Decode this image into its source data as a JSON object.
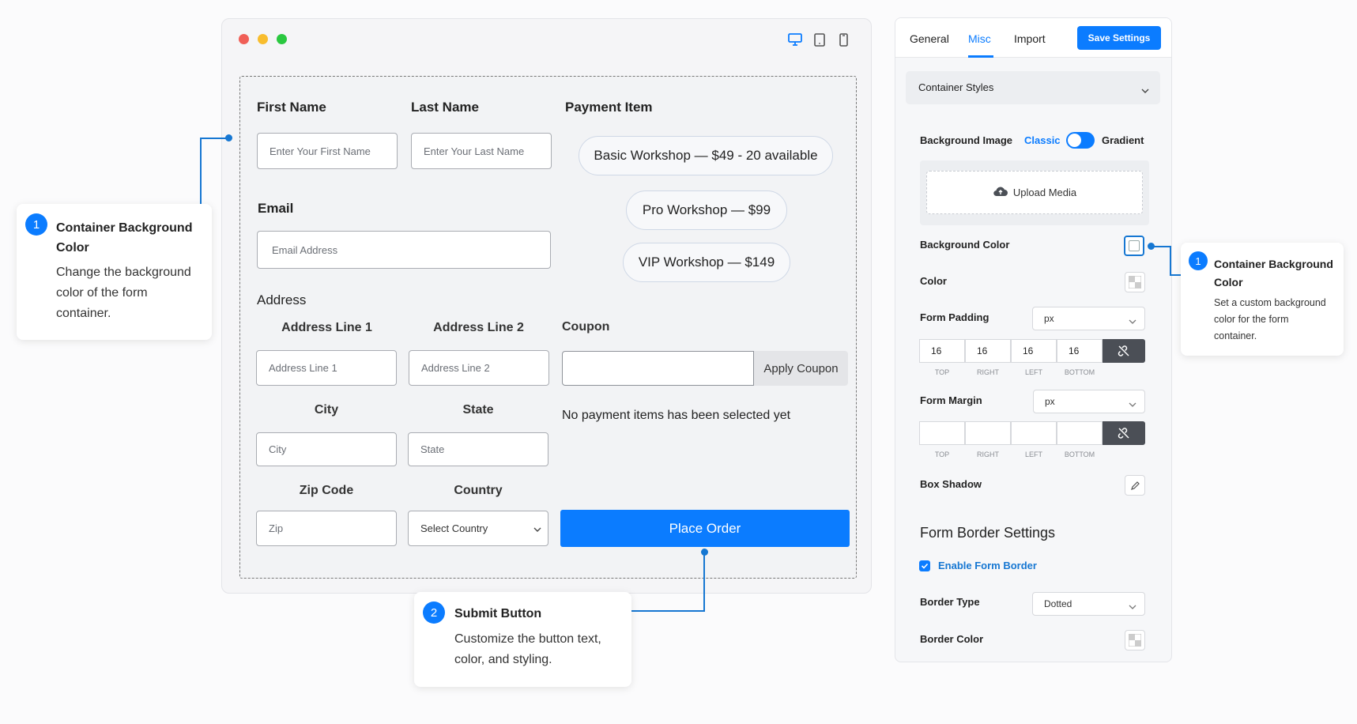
{
  "preview": {
    "devices": [
      "desktop-icon",
      "tablet-icon",
      "mobile-icon"
    ],
    "form": {
      "first_name": {
        "label": "First Name",
        "placeholder": "Enter Your First Name"
      },
      "last_name": {
        "label": "Last Name",
        "placeholder": "Enter Your Last Name"
      },
      "email": {
        "label": "Email",
        "placeholder": "Email Address"
      },
      "address": {
        "label": "Address",
        "line1": {
          "label": "Address Line 1",
          "placeholder": "Address Line 1"
        },
        "line2": {
          "label": "Address Line 2",
          "placeholder": "Address Line 2"
        },
        "city": {
          "label": "City",
          "placeholder": "City"
        },
        "state": {
          "label": "State",
          "placeholder": "State"
        },
        "zip": {
          "label": "Zip Code",
          "placeholder": "Zip"
        },
        "country": {
          "label": "Country",
          "placeholder": "Select Country"
        }
      },
      "payment": {
        "label": "Payment Item",
        "items": [
          "Basic Workshop — $49 - 20 available",
          "Pro Workshop — $99",
          "VIP Workshop — $149"
        ]
      },
      "coupon": {
        "label": "Coupon",
        "button": "Apply Coupon"
      },
      "no_items_msg": "No payment items has been selected yet",
      "submit": "Place Order"
    }
  },
  "callouts": {
    "left": {
      "number": "1",
      "title_line1": "Container Background",
      "title_line2": "Color",
      "desc_lines": [
        "Change the background",
        "color of the form",
        "container."
      ]
    },
    "bottom": {
      "number": "2",
      "title": "Submit Button",
      "desc_lines": [
        "Customize the button text,",
        "color, and styling."
      ]
    },
    "right": {
      "number": "1",
      "title_line1": "Container Background",
      "title_line2": "Color",
      "desc_lines": [
        "Set a custom background",
        "color for the form",
        "container."
      ]
    }
  },
  "settings": {
    "tabs": [
      "General",
      "Misc",
      "Import"
    ],
    "active_tab": "Misc",
    "save_label": "Save Settings",
    "section_title": "Container Styles",
    "background_image": {
      "label": "Background Image",
      "classic": "Classic",
      "gradient": "Gradient",
      "upload": "Upload Media"
    },
    "background_color_label": "Background Color",
    "color_label": "Color",
    "form_padding": {
      "label": "Form Padding",
      "unit": "px",
      "values": [
        "16",
        "16",
        "16",
        "16"
      ],
      "captions": [
        "TOP",
        "RIGHT",
        "LEFT",
        "BOTTOM"
      ]
    },
    "form_margin": {
      "label": "Form Margin",
      "unit": "px",
      "values": [
        "",
        "",
        "",
        ""
      ],
      "captions": [
        "TOP",
        "RIGHT",
        "LEFT",
        "BOTTOM"
      ]
    },
    "box_shadow_label": "Box Shadow",
    "border_settings": {
      "title": "Form Border Settings",
      "enable_label": "Enable Form Border",
      "enabled": true,
      "border_type_label": "Border Type",
      "border_type_value": "Dotted",
      "border_color_label": "Border Color"
    }
  },
  "colors": {
    "accent": "#0b7cff",
    "dot_red": "#f05f57",
    "dot_yellow": "#f8bd2e",
    "dot_green": "#2ac840"
  }
}
